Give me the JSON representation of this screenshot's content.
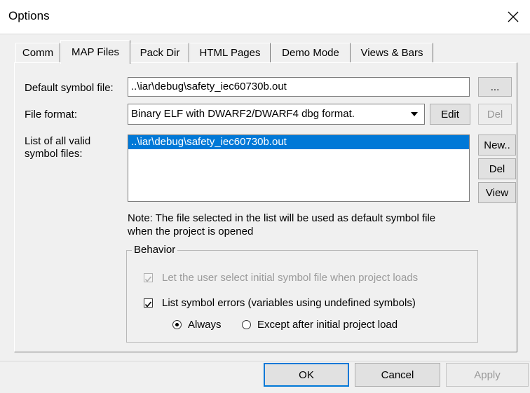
{
  "window": {
    "title": "Options"
  },
  "tabs": [
    {
      "label": "Comm"
    },
    {
      "label": "MAP Files"
    },
    {
      "label": "Pack Dir"
    },
    {
      "label": "HTML Pages"
    },
    {
      "label": "Demo Mode"
    },
    {
      "label": "Views & Bars"
    }
  ],
  "map": {
    "default_symbol_label": "Default symbol file:",
    "default_symbol_value": "..\\iar\\debug\\safety_iec60730b.out",
    "browse_label": "...",
    "file_format_label": "File format:",
    "file_format_value": "Binary ELF with DWARF2/DWARF4 dbg format.",
    "edit_label": "Edit",
    "del_format_label": "Del",
    "list_label_line1": "List of all valid",
    "list_label_line2": "symbol files:",
    "symbol_files": [
      "..\\iar\\debug\\safety_iec60730b.out"
    ],
    "new_label": "New..",
    "del_label": "Del",
    "view_label": "View",
    "note_line1": "Note: The file selected in the list will be used as default symbol file",
    "note_line2": "when the project is opened"
  },
  "behavior": {
    "title": "Behavior",
    "let_user_select": "Let the user select initial symbol file when project loads",
    "list_errors": "List symbol errors (variables using undefined symbols)",
    "always": "Always",
    "except_after": "Except after initial project load"
  },
  "footer": {
    "ok": "OK",
    "cancel": "Cancel",
    "apply": "Apply"
  }
}
